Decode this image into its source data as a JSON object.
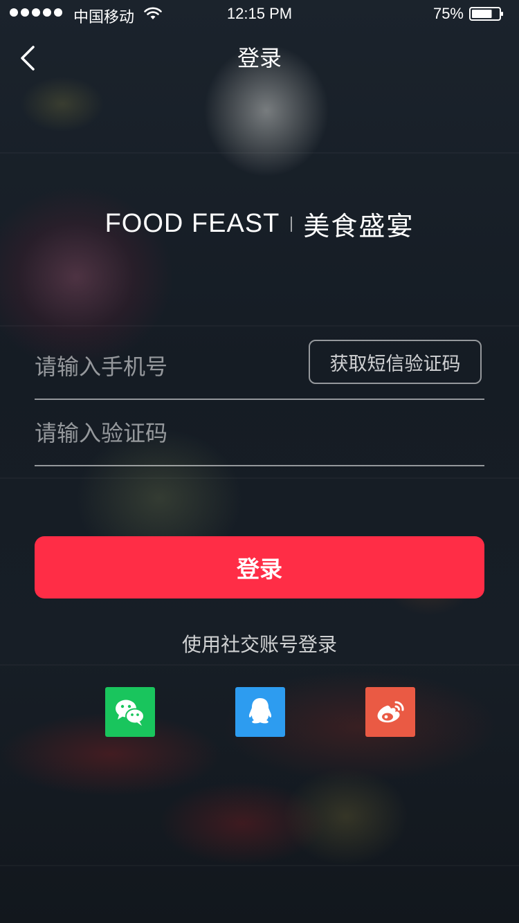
{
  "status_bar": {
    "carrier": "中国移动",
    "time": "12:15 PM",
    "battery": "75%",
    "battery_level": 0.75
  },
  "nav": {
    "title": "登录",
    "back_icon": "chevron-left-icon"
  },
  "brand": {
    "english": "FOOD FEAST",
    "chinese": "美食盛宴"
  },
  "form": {
    "phone_placeholder": "请输入手机号",
    "sms_button": "获取短信验证码",
    "code_placeholder": "请输入验证码",
    "login_button": "登录"
  },
  "social": {
    "caption": "使用社交账号登录",
    "providers": [
      {
        "id": "wechat",
        "icon": "wechat-icon",
        "color": "#19c55d"
      },
      {
        "id": "qq",
        "icon": "qq-icon",
        "color": "#2d9cf0"
      },
      {
        "id": "weibo",
        "icon": "weibo-icon",
        "color": "#ea5a44"
      }
    ]
  },
  "colors": {
    "accent": "#ff2d46"
  }
}
